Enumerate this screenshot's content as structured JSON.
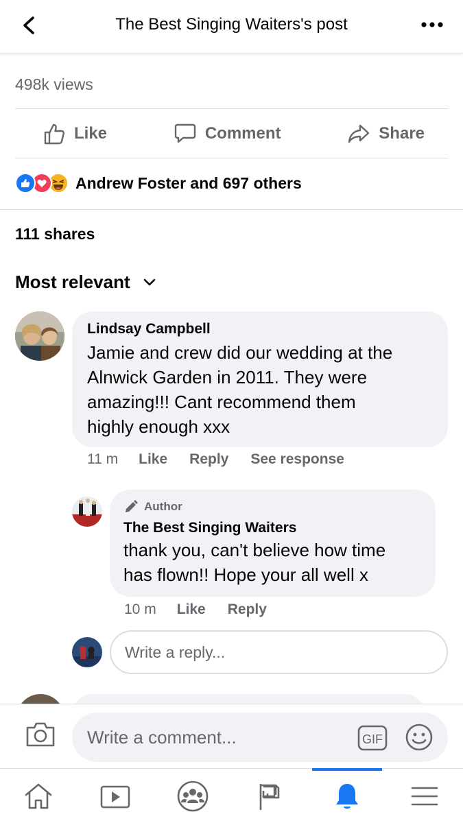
{
  "header": {
    "title": "The Best Singing Waiters's post"
  },
  "post": {
    "views": "498k views",
    "actions": {
      "like": "Like",
      "comment": "Comment",
      "share": "Share"
    },
    "reactions_text": "Andrew Foster and 697 others",
    "shares": "111 shares"
  },
  "sort": {
    "label": "Most relevant"
  },
  "comments": [
    {
      "author": "Lindsay Campbell",
      "text": "Jamie and crew did our wedding at the Alnwick Garden in 2011. They were amazing!!! Cant recommend them highly enough xxx",
      "lines": [
        "Jamie and crew did our wedding at the",
        "Alnwick Garden in 2011. They were",
        "amazing!!! Cant recommend them",
        "highly enough xxx"
      ],
      "time": "11 m",
      "like": "Like",
      "reply": "Reply",
      "see_response": "See response",
      "replies": [
        {
          "badge": "Author",
          "author": "The Best Singing Waiters",
          "lines": [
            "thank you, can't believe how time",
            "has flown!! Hope your all well x"
          ],
          "time": "10 m",
          "like": "Like",
          "reply": "Reply"
        }
      ]
    }
  ],
  "reply_input": {
    "placeholder": "Write a reply..."
  },
  "composer": {
    "placeholder": "Write a comment...",
    "gif": "GIF"
  },
  "tabs": [
    "home",
    "watch",
    "groups",
    "pages",
    "notifications",
    "menu"
  ],
  "colors": {
    "accent": "#1877f2",
    "bubble": "#f0f2f5",
    "secondary_text": "#65676b"
  }
}
